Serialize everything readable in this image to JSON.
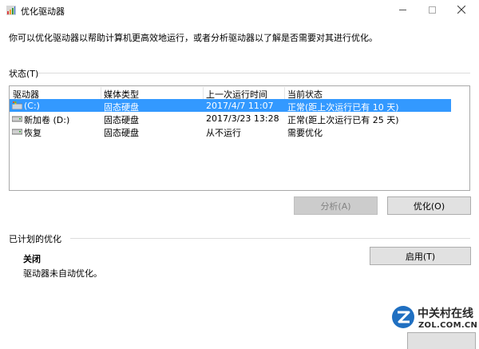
{
  "window": {
    "title": "优化驱动器",
    "description": "你可以优化驱动器以帮助计算机更高效地运行，或者分析驱动器以了解是否需要对其进行优化。"
  },
  "status": {
    "label": "状态(T)",
    "columns": [
      "驱动器",
      "媒体类型",
      "上一次运行时间",
      "当前状态"
    ],
    "rows": [
      {
        "drive": "(C:)",
        "media": "固态硬盘",
        "last_run": "2017/4/7 11:07",
        "status": "正常(距上次运行已有 10 天)",
        "icon": "windows-drive-icon",
        "selected": true
      },
      {
        "drive": "新加卷 (D:)",
        "media": "固态硬盘",
        "last_run": "2017/3/23 13:28",
        "status": "正常(距上次运行已有 25 天)",
        "icon": "hard-drive-icon",
        "selected": false
      },
      {
        "drive": "恢复",
        "media": "固态硬盘",
        "last_run": "从不运行",
        "status": "需要优化",
        "icon": "hard-drive-icon",
        "selected": false
      }
    ]
  },
  "actions": {
    "analyze": "分析(A)",
    "optimize": "优化(O)"
  },
  "scheduled": {
    "label": "已计划的优化",
    "state": "关闭",
    "detail": "驱动器未自动优化。",
    "enable": "启用(T)"
  },
  "watermark": {
    "cn": "中关村在线",
    "en": "ZOL.COM.CN"
  },
  "colors": {
    "selection": "#3399ff",
    "button": "#e1e1e1",
    "button_disabled": "#cccccc"
  }
}
